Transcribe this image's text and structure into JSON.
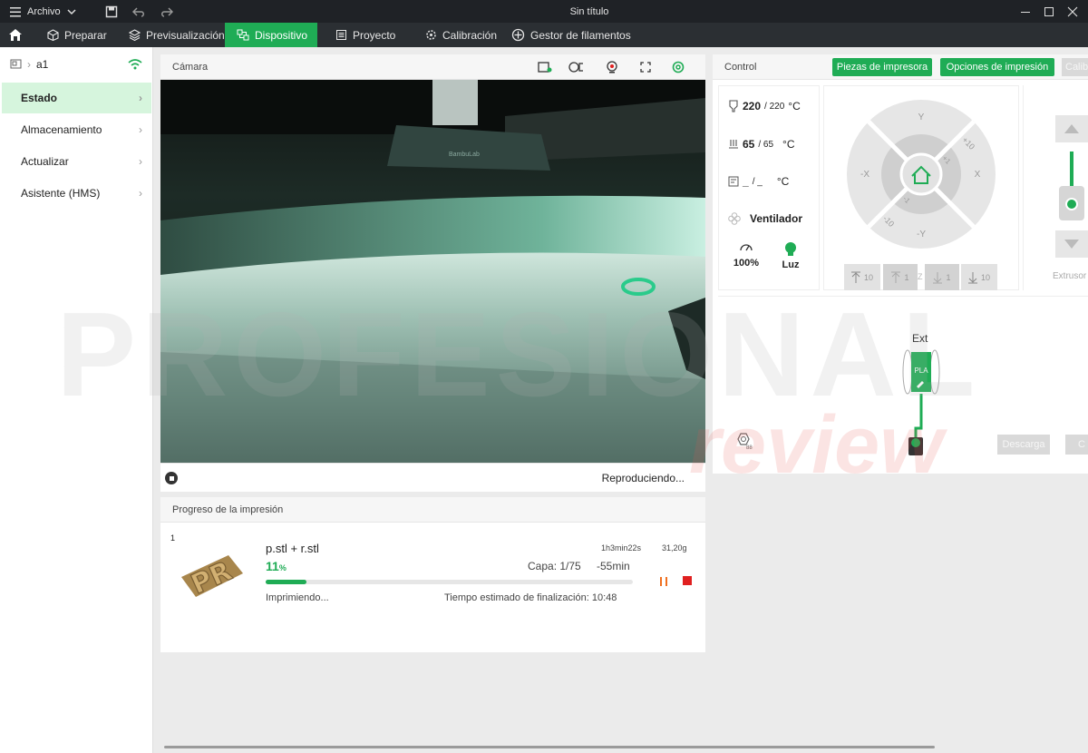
{
  "titlebar": {
    "menu_label": "Archivo",
    "doc_title": "Sin título"
  },
  "tabs": [
    {
      "label": "Preparar",
      "icon": "cube-icon"
    },
    {
      "label": "Previsualización",
      "icon": "layers-icon"
    },
    {
      "label": "Dispositivo",
      "icon": "device-icon",
      "active": true
    },
    {
      "label": "Proyecto",
      "icon": "document-icon"
    },
    {
      "label": "Calibración",
      "icon": "calibration-icon"
    },
    {
      "label": "Gestor de filamentos",
      "icon": "filament-icon"
    }
  ],
  "sidebar": {
    "printer_name": "a1",
    "items": [
      {
        "label": "Estado",
        "active": true
      },
      {
        "label": "Almacenamiento"
      },
      {
        "label": "Actualizar"
      },
      {
        "label": "Asistente (HMS)"
      }
    ]
  },
  "camera": {
    "title": "Cámara",
    "status": "Reproduciendo...",
    "brand_text": "BambuLab"
  },
  "progress": {
    "title": "Progreso de la impresión",
    "plate_number": "1",
    "file_name": "p.stl + r.stl",
    "time_total": "1h3min22s",
    "weight": "31,20g",
    "percent": "11",
    "percent_symbol": "%",
    "percent_value": 11,
    "layer": "Capa: 1/75",
    "remaining": "-55min",
    "status": "Imprimiendo...",
    "eta": "Tiempo estimado de finalización: 10:48",
    "thumbnail_text": "PR"
  },
  "control": {
    "title": "Control",
    "btn_parts": "Piezas de impresora",
    "btn_options": "Opciones de impresión",
    "btn_calib": "Calib",
    "nozzle_temp": "220",
    "nozzle_target": "/ 220",
    "bed_temp": "65",
    "bed_target": "/ 65",
    "chamber_temp": "_",
    "chamber_target": "/ _",
    "temp_unit": "°C",
    "fan_label": "Ventilador",
    "speed_label": "100%",
    "light_label": "Luz",
    "jog": {
      "y_pos": "Y",
      "y_neg": "-Y",
      "x_pos": "X",
      "x_neg": "-X",
      "p10": "+10",
      "p1": "+1",
      "m1": "-1",
      "m10": "-10"
    },
    "z_buttons": [
      "10",
      "1",
      "1",
      "10"
    ],
    "z_label": "Z",
    "extruder_label": "Extrusor",
    "ext_label": "Ext",
    "filament_label": "PLA",
    "btn_unload": "Descarga",
    "btn_load": "C"
  },
  "colors": {
    "accent": "#1fac55",
    "titlebar": "#1f2226",
    "tabbar": "#2b2f33",
    "active_side": "#d6f5dd",
    "stop_red": "#e02020",
    "pause_orange": "#f07020"
  },
  "watermark": {
    "line1": "PROFESIONAL",
    "line2": "review"
  }
}
